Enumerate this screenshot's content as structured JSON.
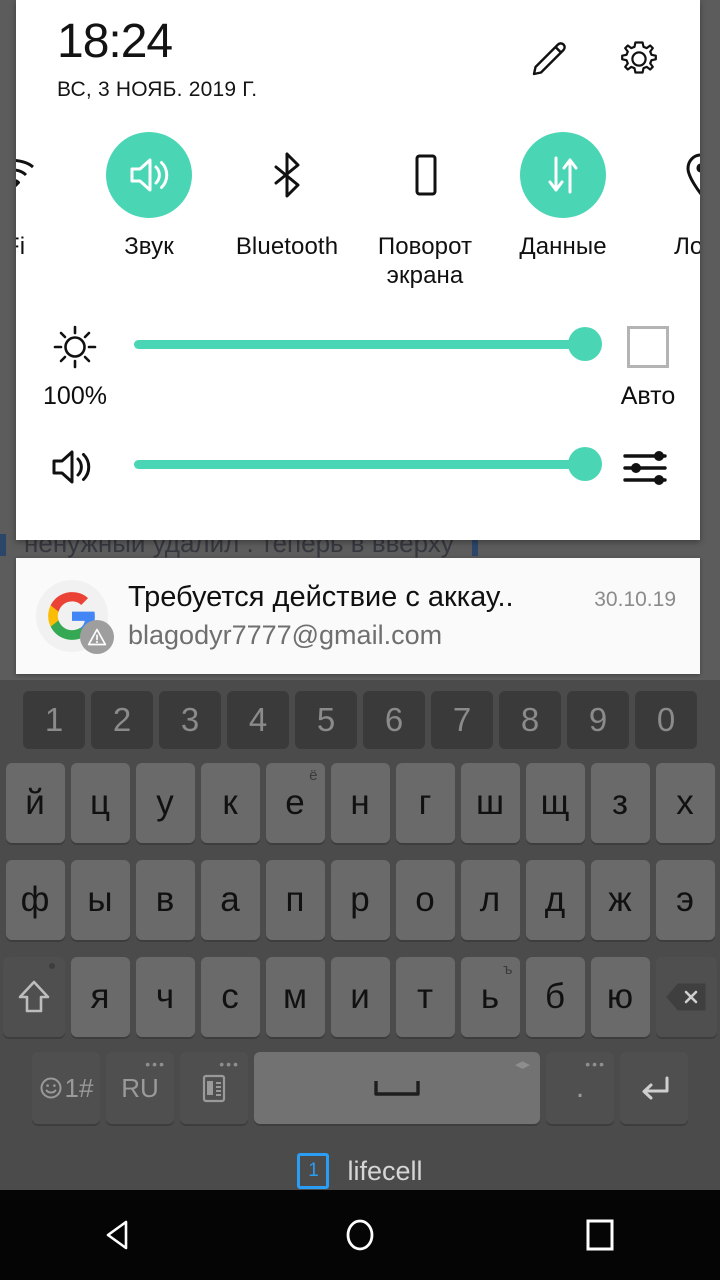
{
  "colors": {
    "accent_teal": "#4ad6b4",
    "panel_bg": "#ffffff",
    "notification_bg": "#fafafa",
    "keyboard_bg": "#4b4b4b",
    "key_bg": "#6a6a6a",
    "navbar_bg": "#050505",
    "sim_blue": "#2a9df4"
  },
  "background_app": {
    "visible_text": "ненужный удалил . теперь в вверху"
  },
  "quick_settings": {
    "time": "18:24",
    "date": "ВС, 3 НОЯБ. 2019 Г.",
    "edit_icon": "pencil-icon",
    "settings_icon": "gear-icon",
    "tiles": [
      {
        "label": "-Fi",
        "icon": "wifi-icon",
        "active": false
      },
      {
        "label": "Звук",
        "icon": "sound-icon",
        "active": true
      },
      {
        "label": "Bluetooth",
        "icon": "bluetooth-icon",
        "active": false
      },
      {
        "label": "Поворот экрана",
        "icon": "rotate-screen-icon",
        "active": false
      },
      {
        "label": "Данные",
        "icon": "mobile-data-icon",
        "active": true
      },
      {
        "label": "Лока",
        "icon": "location-icon",
        "active": false
      }
    ],
    "brightness": {
      "icon": "brightness-icon",
      "value_label": "100%",
      "percent": 100,
      "auto_label": "Авто",
      "auto_checked": false
    },
    "volume": {
      "icon": "volume-icon",
      "percent": 100,
      "settings_icon": "equalizer-icon"
    }
  },
  "notification": {
    "app_icon": "google-icon",
    "badge_icon": "warning-icon",
    "title": "Требуется действие с аккау..",
    "subtitle": "blagodyr7777@gmail.com",
    "time": "30.10.19"
  },
  "keyboard": {
    "numbers": [
      "1",
      "2",
      "3",
      "4",
      "5",
      "6",
      "7",
      "8",
      "9",
      "0"
    ],
    "row1": [
      {
        "key": "й"
      },
      {
        "key": "ц"
      },
      {
        "key": "у"
      },
      {
        "key": "к"
      },
      {
        "key": "е",
        "sup": "ё"
      },
      {
        "key": "н"
      },
      {
        "key": "г"
      },
      {
        "key": "ш"
      },
      {
        "key": "щ"
      },
      {
        "key": "з"
      },
      {
        "key": "х"
      }
    ],
    "row2": [
      {
        "key": "ф"
      },
      {
        "key": "ы"
      },
      {
        "key": "в"
      },
      {
        "key": "а"
      },
      {
        "key": "п"
      },
      {
        "key": "р"
      },
      {
        "key": "о"
      },
      {
        "key": "л"
      },
      {
        "key": "д"
      },
      {
        "key": "ж"
      },
      {
        "key": "э"
      }
    ],
    "row3": [
      {
        "key": "я"
      },
      {
        "key": "ч"
      },
      {
        "key": "с"
      },
      {
        "key": "м"
      },
      {
        "key": "и"
      },
      {
        "key": "т"
      },
      {
        "key": "ь",
        "sup": "ъ"
      },
      {
        "key": "б"
      },
      {
        "key": "ю"
      }
    ],
    "shift_icon": "shift-icon",
    "backspace_icon": "backspace-icon",
    "symbols_label": "1#",
    "symbols_icon": "emoji-icon",
    "language_label": "RU",
    "clipboard_icon": "clipboard-icon",
    "space_icon": "spacebar-icon",
    "period_label": ".",
    "enter_icon": "enter-icon"
  },
  "carrier": {
    "sim_slot": "1",
    "name": "lifecell"
  },
  "navbar": {
    "back_icon": "back-triangle-icon",
    "home_icon": "home-circle-icon",
    "recents_icon": "recents-square-icon"
  }
}
